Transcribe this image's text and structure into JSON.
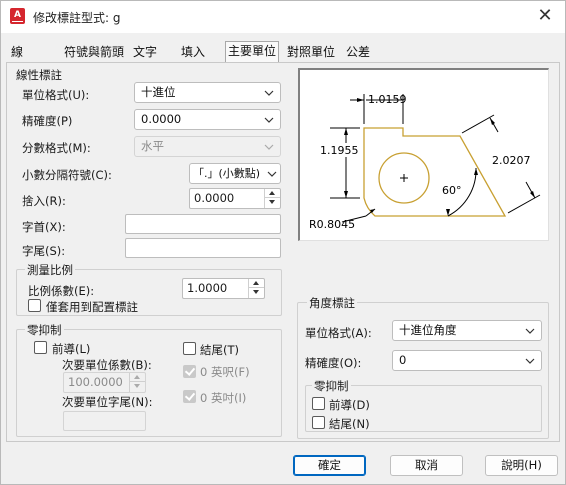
{
  "window": {
    "title": "修改標註型式: g",
    "app_icon_letter": "A",
    "close_glyph": "✕"
  },
  "tabs": [
    "線",
    "符號與箭頭",
    "文字",
    "填入",
    "主要單位",
    "對照單位",
    "公差"
  ],
  "active_tab": "主要單位",
  "linear": {
    "group_label": "線性標註",
    "unit_format_label": "單位格式(U):",
    "unit_format_value": "十進位",
    "precision_label": "精確度(P)",
    "precision_value": "0.0000",
    "fraction_format_label": "分數格式(M):",
    "fraction_format_value": "水平",
    "decimal_separator_label": "小數分隔符號(C):",
    "decimal_separator_value": "「.」(小數點)",
    "round_off_label": "捨入(R):",
    "round_off_value": "0.0000",
    "prefix_label": "字首(X):",
    "prefix_value": "",
    "suffix_label": "字尾(S):",
    "suffix_value": ""
  },
  "measurement_scale": {
    "group_label": "測量比例",
    "scale_factor_label": "比例係數(E):",
    "scale_factor_value": "1.0000",
    "layout_only_label": "僅套用到配置標註"
  },
  "zero_suppression": {
    "group_label": "零抑制",
    "leading_label": "前導(L)",
    "trailing_label": "結尾(T)",
    "sub_units_factor_label": "次要單位係數(B):",
    "sub_units_factor_value": "100.0000",
    "sub_unit_suffix_label": "次要單位字尾(N):",
    "zero_feet_label": "0 英呎(F)",
    "zero_inches_label": "0 英吋(I)"
  },
  "preview": {
    "dim_top": "1.0159",
    "dim_left": "1.1955",
    "dim_right": "2.0207",
    "dim_angle": "60°",
    "dim_radius": "R0.8045"
  },
  "angular": {
    "group_label": "角度標註",
    "unit_format_label": "單位格式(A):",
    "unit_format_value": "十進位角度",
    "precision_label": "精確度(O):",
    "precision_value": "0",
    "zero_group_label": "零抑制",
    "leading_label": "前導(D)",
    "trailing_label": "結尾(N)"
  },
  "buttons": {
    "ok": "確定",
    "cancel": "取消",
    "help": "說明(H)"
  },
  "colors": {
    "preview_shape": "#c8a032",
    "accent": "#0067c0",
    "app_icon": "#d5262e"
  }
}
